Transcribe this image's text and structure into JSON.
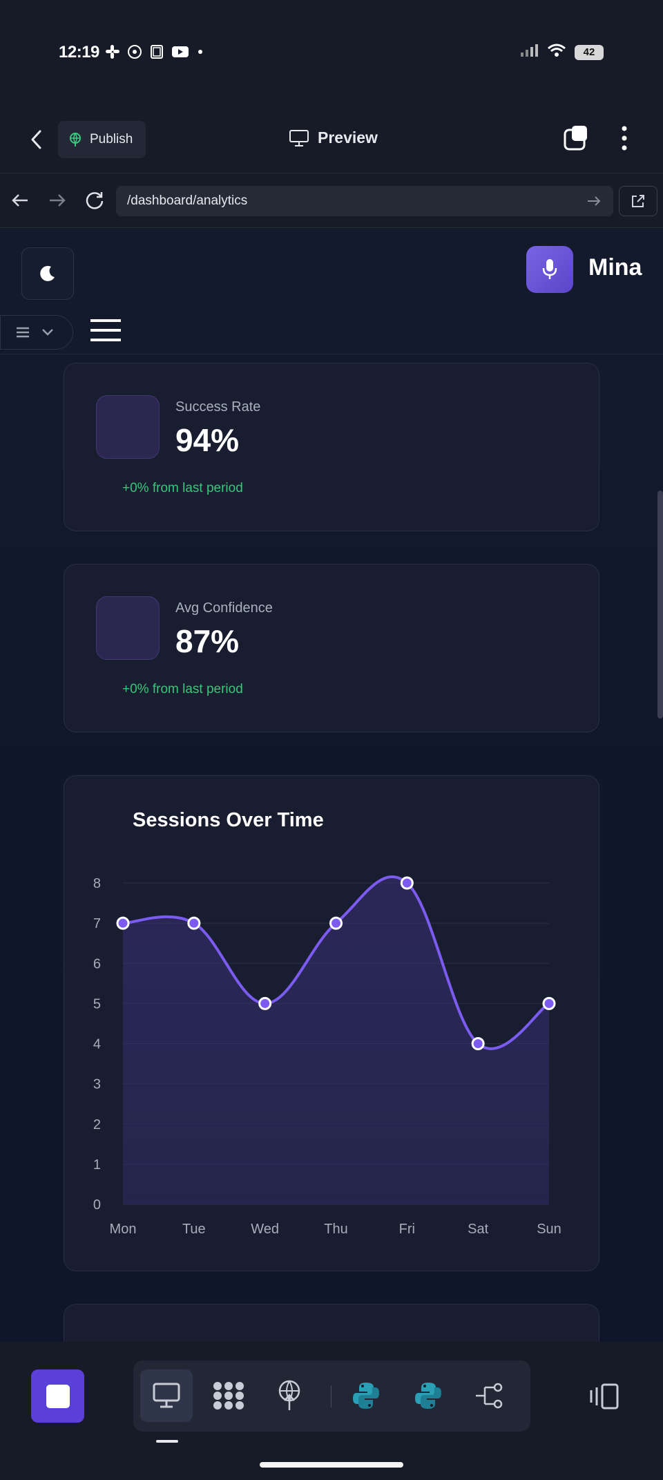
{
  "status_bar": {
    "time": "12:19",
    "battery": "42"
  },
  "header": {
    "publish_label": "Publish",
    "preview_label": "Preview"
  },
  "url_bar": {
    "url": "/dashboard/analytics"
  },
  "app": {
    "brand": "Mina"
  },
  "stats": [
    {
      "label": "Success Rate",
      "value": "94%",
      "delta": "+0% from last period"
    },
    {
      "label": "Avg Confidence",
      "value": "87%",
      "delta": "+0% from last period"
    }
  ],
  "colors": {
    "accent": "#7c5cf0",
    "positive": "#39c77a",
    "stop_button": "#5b3fd9"
  },
  "chart_data": {
    "type": "line",
    "title": "Sessions Over Time",
    "categories": [
      "Mon",
      "Tue",
      "Wed",
      "Thu",
      "Fri",
      "Sat",
      "Sun"
    ],
    "values": [
      7,
      7,
      5,
      7,
      8,
      4,
      5
    ],
    "ylim": [
      0,
      8
    ],
    "yticks": [
      "0",
      "1",
      "2",
      "3",
      "4",
      "5",
      "6",
      "7",
      "8"
    ],
    "grid": true,
    "area_fill": true
  },
  "icons": {
    "status": [
      "slack-icon",
      "whatsapp-icon",
      "notes-icon",
      "youtube-icon",
      "dot-icon"
    ],
    "bottom_tools": [
      "monitor-icon",
      "cluster-icon",
      "deploy-icon",
      "python-icon",
      "python-icon",
      "share-nodes-icon"
    ]
  }
}
